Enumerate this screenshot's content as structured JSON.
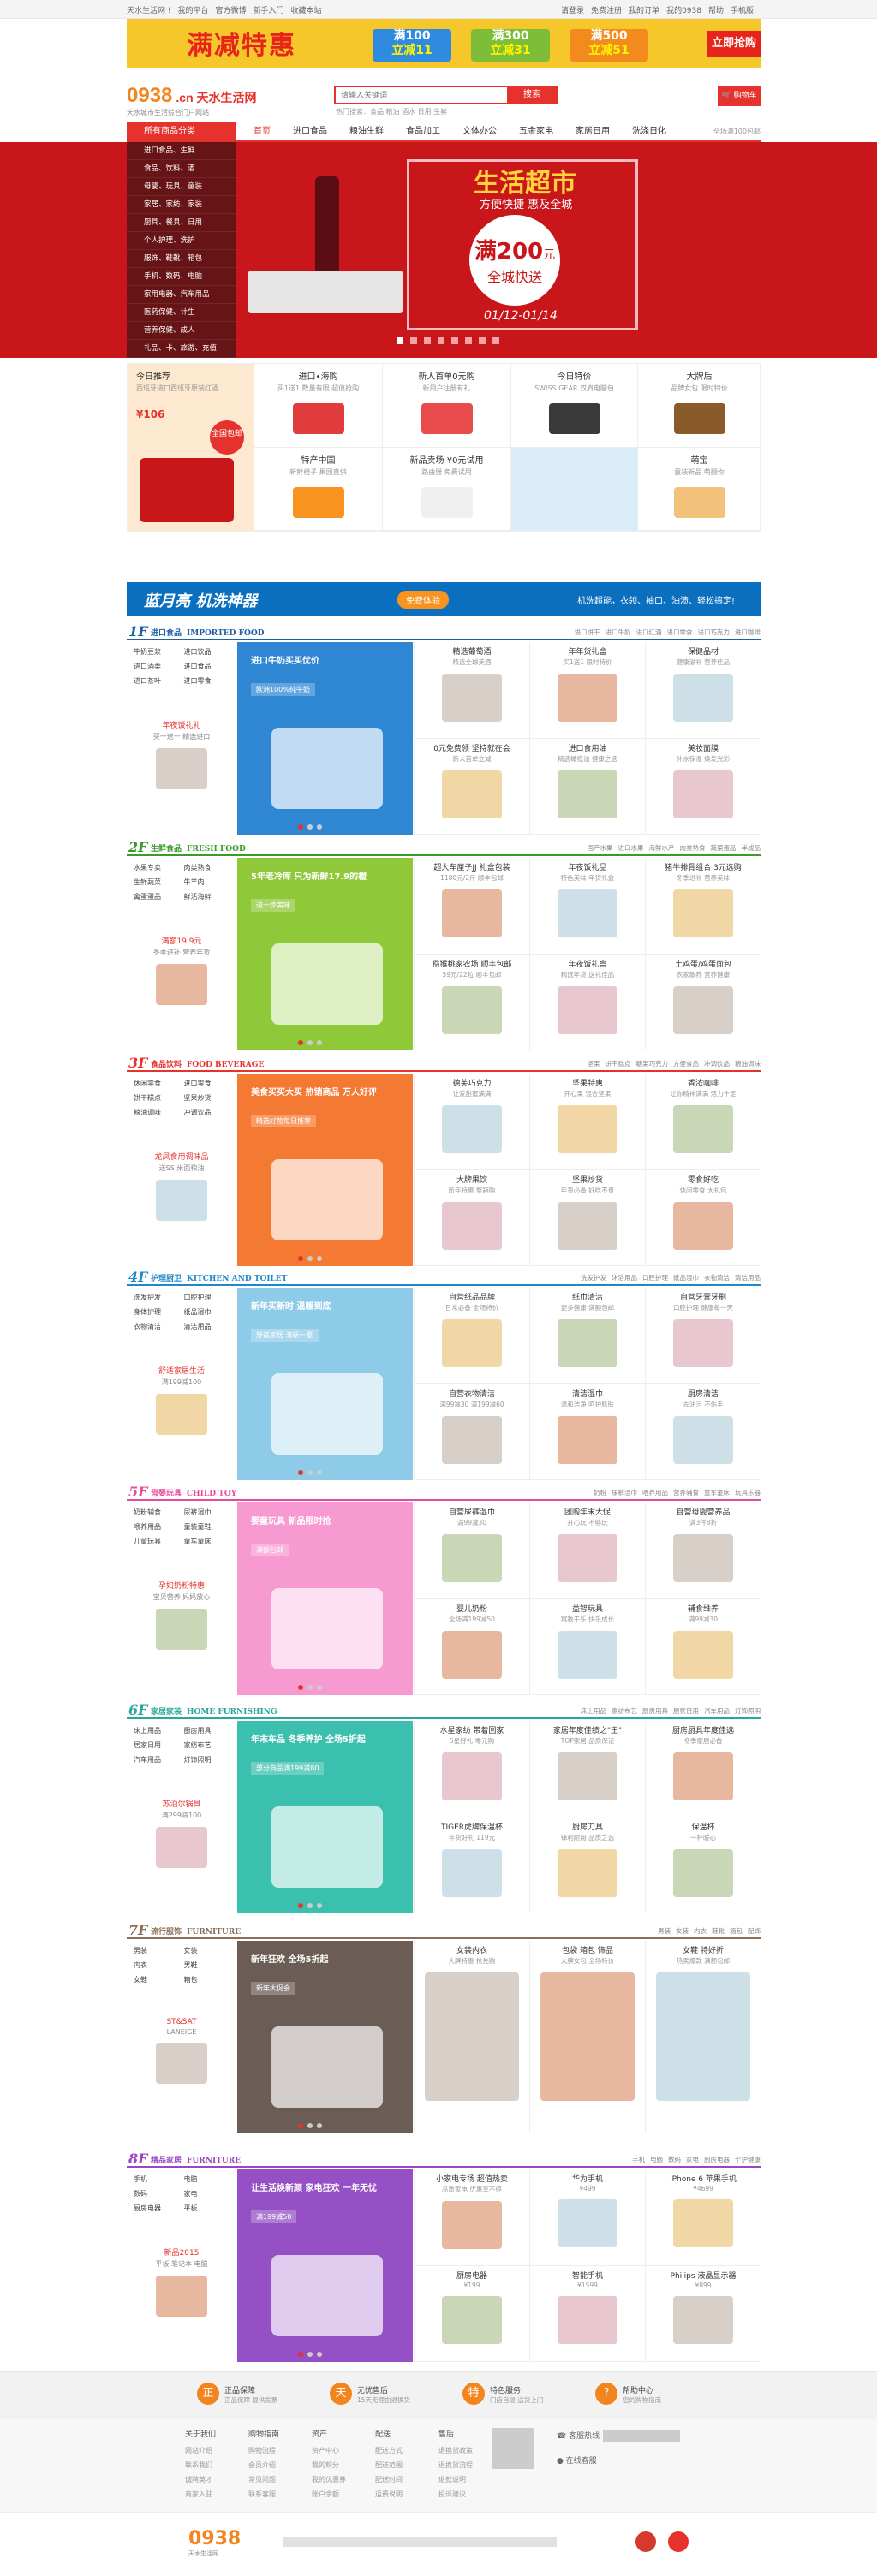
{
  "topbar": {
    "left": [
      "天水生活网 !",
      "我的平台",
      "官方微博",
      "新手入门",
      "收藏本站"
    ],
    "right": [
      "请登录",
      "免费注册",
      "我的订单",
      "我的0938",
      "帮助",
      "手机版"
    ]
  },
  "promo": {
    "title": "满减特惠",
    "coupons": [
      {
        "top": "满100",
        "bottom": "立减11",
        "color": "#2f8be0"
      },
      {
        "top": "满300",
        "bottom": "立减31",
        "color": "#7dbd38"
      },
      {
        "top": "满500",
        "bottom": "立减51",
        "color": "#f28a1e"
      }
    ],
    "grab": "立即抢购"
  },
  "header": {
    "logo": "0938",
    "logo_cn": ".cn 天水生活网",
    "logo_sub": "天水城市生活综合门户网站",
    "search_placeholder": "请输入关键词",
    "search_button": "搜索",
    "hotwords": "热门搜索：食品  粮油  酒水  日用  生鲜",
    "cart": "购物车"
  },
  "nav": {
    "category_title": "所有商品分类",
    "items": [
      "首页",
      "进口食品",
      "粮油生鲜",
      "食品加工",
      "文体办公",
      "五金家电",
      "家居日用",
      "洗涤日化"
    ],
    "tip": "全场满100包邮"
  },
  "sidemenu": [
    "进口食品、生鲜",
    "食品、饮料、酒",
    "母婴、玩具、童装",
    "家居、家纺、家装",
    "厨具、餐具、日用",
    "个人护理、洗护",
    "服饰、鞋靴、箱包",
    "手机、数码、电脑",
    "家用电器、汽车用品",
    "医药保健、计生",
    "营养保健、成人",
    "礼品、卡、旅游、充值"
  ],
  "hero": {
    "title": "生活超市",
    "subtitle": "方便快捷  惠及全城",
    "circle_top": "满200",
    "circle_unit": "元",
    "circle_bottom": "全城快送",
    "date": "01/12-01/14",
    "dots": 8
  },
  "deals": {
    "feature": {
      "title": "今日推荐",
      "desc": "西班牙进口西班牙原装红酒",
      "price": "¥106",
      "tag": "全国包邮"
    },
    "cells": [
      {
        "title": "进口•海购",
        "desc": "买1送1 数量有限 超值抢购"
      },
      {
        "title": "新人首单0元购",
        "desc": "新用户注册有礼"
      },
      {
        "title": "今日特价",
        "desc": "SWISS GEAR 双肩电脑包"
      },
      {
        "title": "大牌后",
        "desc": "品牌女包 限时特价"
      },
      {
        "title": "特产中国",
        "desc": "新鲜橙子 果园直供"
      },
      {
        "title": "新品卖场 ¥0元试用",
        "desc": "路由器 免费试用"
      },
      {
        "title": "萌宝",
        "desc": "童装新品 萌翻你"
      }
    ]
  },
  "bluebar": {
    "brand": "蓝月亮 机洗神器",
    "button": "免费体验",
    "slogan": "机洗超能，衣领、袖口、油渍、轻松搞定!"
  },
  "floors": [
    {
      "num": "1F",
      "name": "进口食品",
      "en": "IMPORTED FOOD",
      "color": "#1f5fa8",
      "tags": [
        "进口饼干",
        "进口牛奶",
        "进口红酒",
        "进口零食",
        "进口巧克力",
        "进口咖啡"
      ],
      "links": [
        "牛奶豆浆",
        "进口饮品",
        "进口酒类",
        "进口食品",
        "进口茶叶",
        "进口零食"
      ],
      "promo": {
        "title": "年夜饭礼礼",
        "desc": "买一送一 精选进口"
      },
      "big": {
        "title": "进口牛奶买买优价",
        "sub": "欧洲100%纯牛奶",
        "bg": "#2f87d4"
      },
      "cells": [
        {
          "t": "精选葡萄酒",
          "s": "精选全球美酒"
        },
        {
          "t": "年年货礼盒",
          "s": "买1送1 限时特价"
        },
        {
          "t": "保健品材",
          "s": "健康滋补 营养佳品"
        },
        {
          "t": "0元免费领 坚持就在会",
          "s": "新人首单立减"
        },
        {
          "t": "进口食用油",
          "s": "精选橄榄油 健康之选"
        },
        {
          "t": "美妆面膜",
          "s": "补水保湿 焕发光彩"
        }
      ]
    },
    {
      "num": "2F",
      "name": "生鲜食品",
      "en": "FRESH FOOD",
      "color": "#3a9a2a",
      "tags": [
        "国产水果",
        "进口水果",
        "海鲜水产",
        "肉类熟食",
        "蔬菜蛋品",
        "半成品"
      ],
      "links": [
        "水果专卖",
        "肉类熟食",
        "生鲜蔬菜",
        "牛羊肉",
        "禽蛋蛋品",
        "鲜活海鲜"
      ],
      "promo": {
        "title": "满额19.9元",
        "desc": "冬季进补 营养年货"
      },
      "big": {
        "title": "5年老冷库 只为新鲜17.9的橙",
        "sub": "进一步美味",
        "bg": "#8fc93a"
      },
      "cells": [
        {
          "t": "超大车厘子JJ 礼盒包装",
          "s": "1180元/2斤 顺丰包邮"
        },
        {
          "t": "年夜饭礼品",
          "s": "特色美味 年货礼盒"
        },
        {
          "t": "猪牛排骨组合 3元选购",
          "s": "冬季进补 营养美味"
        },
        {
          "t": "猕猴桃家农场 顺丰包邮",
          "s": "59元/22粒 顺丰包邮"
        },
        {
          "t": "年夜饭礼盒",
          "s": "精选年货 送礼佳品"
        },
        {
          "t": "土鸡蛋/鸡蛋面包",
          "s": "农家散养 营养健康"
        }
      ]
    },
    {
      "num": "3F",
      "name": "食品饮料",
      "en": "FOOD BEVERAGE",
      "color": "#e5322d",
      "tags": [
        "坚果",
        "饼干糕点",
        "糖果巧克力",
        "方便食品",
        "冲调饮品",
        "粮油调味"
      ],
      "links": [
        "休闲零食",
        "进口零食",
        "饼干糕点",
        "坚果炒货",
        "粮油调味",
        "冲调饮品"
      ],
      "promo": {
        "title": "龙凤食用调味品",
        "desc": "送SS 米面粮油"
      },
      "big": {
        "title": "美食买买大买 热销商品 万人好评",
        "sub": "精选好物每日推荐",
        "bg": "#f47a34"
      },
      "cells": [
        {
          "t": "德芙巧克力",
          "s": "让爱甜蜜满满"
        },
        {
          "t": "坚果特惠",
          "s": "开心果 混合坚果"
        },
        {
          "t": "香浓咖啡",
          "s": "让你精神满满 活力十足"
        },
        {
          "t": "大牌果饮",
          "s": "新年特惠 整箱购"
        },
        {
          "t": "坚果炒货",
          "s": "年货必备 好吃不贵"
        },
        {
          "t": "零食好吃",
          "s": "休闲零食 大礼包"
        }
      ]
    },
    {
      "num": "4F",
      "name": "护理厨卫",
      "en": "KITCHEN AND TOILET",
      "color": "#1e88c8",
      "tags": [
        "洗发护发",
        "沐浴用品",
        "口腔护理",
        "纸品湿巾",
        "衣物清洁",
        "清洁用品"
      ],
      "links": [
        "洗发护发",
        "口腔护理",
        "身体护理",
        "纸品湿巾",
        "衣物清洁",
        "清洁用品"
      ],
      "promo": {
        "title": "舒适家居生活",
        "desc": "满199减100"
      },
      "big": {
        "title": "新年买新时 温暖到底",
        "sub": "舒适家居 清新一夏",
        "bg": "#8ecbe8"
      },
      "cells": [
        {
          "t": "自营纸品品牌",
          "s": "日常必备 全场特价"
        },
        {
          "t": "纸巾清洁",
          "s": "更多健康 满额包邮"
        },
        {
          "t": "自营牙膏牙刷",
          "s": "口腔护理 健康每一天"
        },
        {
          "t": "自营衣物清洁",
          "s": "满99减30 满199减60"
        },
        {
          "t": "清洁湿巾",
          "s": "温和洁净 呵护肌肤"
        },
        {
          "t": "厨房清洁",
          "s": "去油污 不伤手"
        }
      ]
    },
    {
      "num": "5F",
      "name": "母婴玩具",
      "en": "CHILD TOY",
      "color": "#e84b9e",
      "tags": [
        "奶粉",
        "尿裤湿巾",
        "喂养用品",
        "营养辅食",
        "童车童床",
        "玩具乐器"
      ],
      "links": [
        "奶粉辅食",
        "尿裤湿巾",
        "喂养用品",
        "童装童鞋",
        "儿童玩具",
        "童车童床"
      ],
      "promo": {
        "title": "孕妇奶粉特惠",
        "desc": "宝贝营养 妈妈放心"
      },
      "big": {
        "title": "婴童玩具 新品限时抢",
        "sub": "满额包邮",
        "bg": "#f79ad2"
      },
      "cells": [
        {
          "t": "自营尿裤湿巾",
          "s": "满99减30"
        },
        {
          "t": "团购年末大促",
          "s": "开心玩 不够玩"
        },
        {
          "t": "自营母婴营养品",
          "s": "满3件8折"
        },
        {
          "t": "婴儿奶粉",
          "s": "全场满199减50"
        },
        {
          "t": "益智玩具",
          "s": "寓教于乐 快乐成长"
        },
        {
          "t": "辅食维养",
          "s": "满99减30"
        }
      ]
    },
    {
      "num": "6F",
      "name": "家居家装",
      "en": "HOME FURNISHING",
      "color": "#2aa79b",
      "tags": [
        "床上用品",
        "家纺布艺",
        "厨房用具",
        "居家日用",
        "汽车用品",
        "灯饰照明"
      ],
      "links": [
        "床上用品",
        "厨房用具",
        "居家日用",
        "家纺布艺",
        "汽车用品",
        "灯饰照明"
      ],
      "promo": {
        "title": "苏泊尔锅具",
        "desc": "满299减100"
      },
      "big": {
        "title": "年末车品 冬季养护 全场5折起",
        "sub": "部分商品满199减80",
        "bg": "#3bbfae"
      },
      "cells": [
        {
          "t": "水星家纺 带着回家",
          "s": "5星好礼 零元购"
        },
        {
          "t": "家居年度佳绩之\"王\"",
          "s": "TOP家居 品质保证"
        },
        {
          "t": "厨房厨具年度佳选",
          "s": "冬季家居必备"
        },
        {
          "t": "TIGER虎牌保温杯",
          "s": "年货好礼 119元"
        },
        {
          "t": "厨房刀具",
          "s": "锋利耐用 品质之选"
        },
        {
          "t": "保温杯",
          "s": "一杯暖心"
        }
      ]
    },
    {
      "num": "7F",
      "name": "流行服饰",
      "en": "FURNITURE",
      "color": "#8b6e55",
      "tags": [
        "男装",
        "女装",
        "内衣",
        "鞋靴",
        "箱包",
        "配饰"
      ],
      "links": [
        "男装",
        "女装",
        "内衣",
        "男鞋",
        "女鞋",
        "箱包"
      ],
      "promo": {
        "title": "ST&SAT",
        "desc": "LANEIGE"
      },
      "big": {
        "title": "新年狂欢 全场5折起",
        "sub": "新年大促会",
        "bg": "#6b5d55"
      },
      "cells": [
        {
          "t": "女装内衣",
          "s": "大牌特惠 抢先购"
        },
        {
          "t": "包袋 箱包 饰品",
          "s": "大牌女包 全场特价"
        },
        {
          "t": "女鞋 特好折",
          "s": "热卖爆款 满额包邮"
        }
      ]
    },
    {
      "num": "8F",
      "name": "精品家居",
      "en": "FURNITURE",
      "color": "#9b44c4",
      "tags": [
        "手机",
        "电脑",
        "数码",
        "家电",
        "厨房电器",
        "个护健康"
      ],
      "links": [
        "手机",
        "电脑",
        "数码",
        "家电",
        "厨房电器",
        "平板"
      ],
      "promo": {
        "title": "新品2015",
        "desc": "平板 笔记本 电脑"
      },
      "big": {
        "title": "让生活焕新颜 家电狂欢 一年无忧",
        "sub": "满199减50",
        "bg": "#9550c6"
      },
      "cells": [
        {
          "t": "小家电专场 超值热卖",
          "s": "品质家电 优惠享不停"
        },
        {
          "t": "华为手机",
          "s": "¥499"
        },
        {
          "t": "iPhone 6 苹果手机",
          "s": "¥4699"
        },
        {
          "t": "厨房电器",
          "s": "¥199"
        },
        {
          "t": "智能手机",
          "s": "¥1599"
        },
        {
          "t": "Philips 液晶显示器",
          "s": "¥899"
        }
      ]
    }
  ],
  "guarantee": [
    {
      "icon": "正",
      "title": "正品保障",
      "desc": "正品保障 提供发票"
    },
    {
      "icon": "天",
      "title": "无忧售后",
      "desc": "15天无理由退换货"
    },
    {
      "icon": "特",
      "title": "特色服务",
      "desc": "门店自提 送货上门"
    },
    {
      "icon": "?",
      "title": "帮助中心",
      "desc": "您的购物指南"
    }
  ],
  "footcols": [
    {
      "h": "关于我们",
      "items": [
        "网站介绍",
        "联系我们",
        "诚聘英才",
        "商家入驻"
      ]
    },
    {
      "h": "购物指南",
      "items": [
        "购物流程",
        "会员介绍",
        "常见问题",
        "联系客服"
      ]
    },
    {
      "h": "资产",
      "items": [
        "资产中心",
        "我的积分",
        "我的优惠券",
        "账户余额"
      ]
    },
    {
      "h": "配送",
      "items": [
        "配送方式",
        "配送范围",
        "配送时间",
        "运费说明"
      ]
    },
    {
      "h": "售后",
      "items": [
        "退换货政策",
        "退换货流程",
        "退款说明",
        "投诉建议"
      ]
    }
  ],
  "hotline": "客服热线",
  "online": "在线客服",
  "footer_logo": "0938",
  "footer_logo_sub": "天水生活网"
}
